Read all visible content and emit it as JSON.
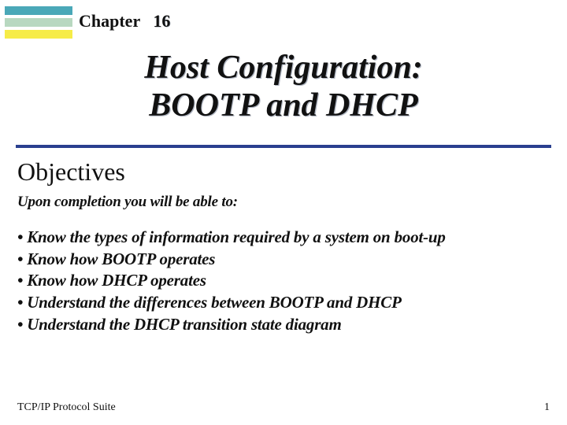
{
  "chapter": {
    "label": "Chapter",
    "number": "16"
  },
  "title": {
    "line1": "Host Configuration:",
    "line2": "BOOTP and DHCP"
  },
  "objectives": {
    "heading": "Objectives",
    "subheading": "Upon completion you will be able to:",
    "bullets": [
      "Know the types of information required by a system on boot-up",
      "Know how BOOTP operates",
      "Know how DHCP operates",
      "Understand the differences between BOOTP and DHCP",
      "Understand the DHCP transition state diagram"
    ]
  },
  "footer": {
    "left": "TCP/IP Protocol Suite",
    "right": "1"
  },
  "colors": {
    "divider": "#2a3f8f",
    "bar_cyan": "#4aa8b8",
    "bar_green": "#b8d8c0",
    "bar_yellow": "#f6ec48"
  }
}
